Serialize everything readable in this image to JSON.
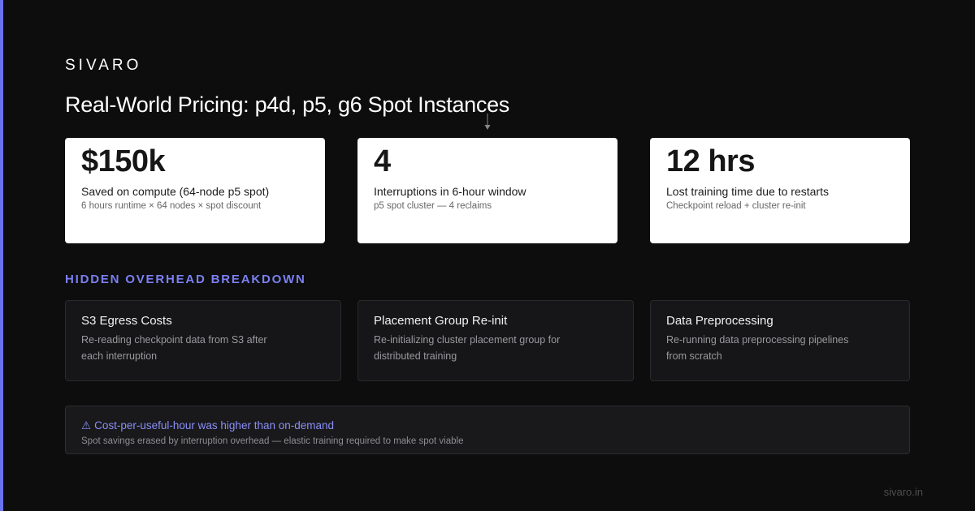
{
  "brand": "SIVARO",
  "title": "Real-World Pricing: p4d, p5, g6 Spot Instances",
  "stats": [
    {
      "value": "$150k",
      "label": "Saved on compute (64-node p5 spot)",
      "sub": "6 hours runtime × 64 nodes × spot discount"
    },
    {
      "value": "4",
      "label": "Interruptions in 6-hour window",
      "sub": "p5 spot cluster — 4 reclaims"
    },
    {
      "value": "12 hrs",
      "label": "Lost training time due to restarts",
      "sub": "Checkpoint reload + cluster re-init"
    }
  ],
  "overhead": {
    "heading": "HIDDEN OVERHEAD BREAKDOWN",
    "items": [
      {
        "title": "S3 Egress Costs",
        "desc": "Re-reading checkpoint data from S3 after each interruption"
      },
      {
        "title": "Placement Group Re-init",
        "desc": "Re-initializing cluster placement group for distributed training"
      },
      {
        "title": "Data Preprocessing",
        "desc": "Re-running data preprocessing pipelines from scratch"
      }
    ]
  },
  "alert": {
    "icon": "⚠",
    "title": "Cost-per-useful-hour was higher than on-demand",
    "desc": "Spot savings erased by interruption overhead — elastic training required to make spot viable"
  },
  "footer": {
    "url": "sivaro.in"
  },
  "colors": {
    "accent": "#6b72f0",
    "heading": "#7b80f2",
    "background": "#0d0d0d"
  }
}
